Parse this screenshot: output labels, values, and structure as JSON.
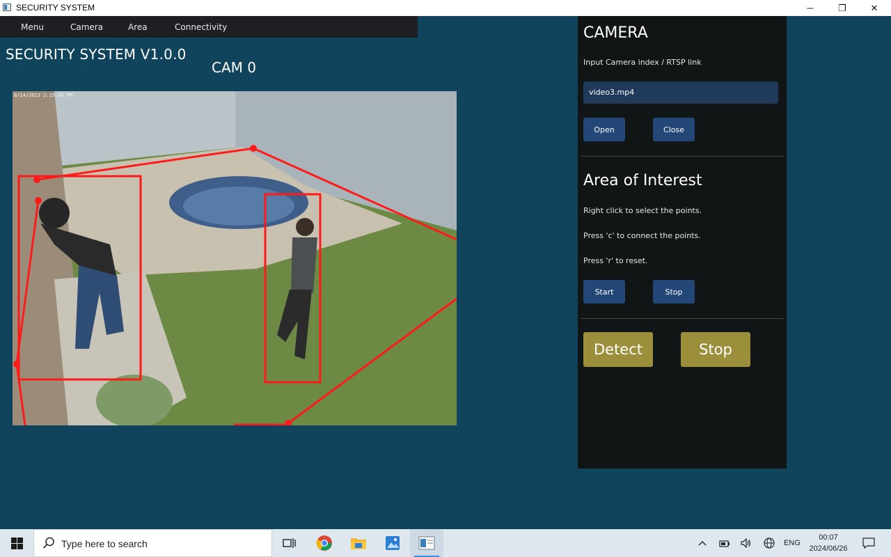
{
  "window": {
    "title": "SECURITY SYSTEM",
    "controls": {
      "minimize": "─",
      "restore": "❐",
      "close": "✕"
    }
  },
  "menubar": {
    "items": [
      "Menu",
      "Camera",
      "Area",
      "Connectivity"
    ]
  },
  "main": {
    "app_title": "SECURITY SYSTEM V1.0.0",
    "cam_label": "CAM 0",
    "video_timestamp": "8/14/2013 2:15:49 PM",
    "overlay_color": "#ff1a1a"
  },
  "panel": {
    "camera_heading": "CAMERA",
    "camera_prompt": "Input Camera index / RTSP link",
    "camera_input_value": "video3.mp4",
    "open_label": "Open",
    "close_label": "Close",
    "area_heading": "Area of Interest",
    "instructions": [
      "Right click to select the points.",
      "Press 'c' to connect the points.",
      "Press 'r' to reset."
    ],
    "start_label": "Start",
    "stop_label": "Stop",
    "detect_label": "Detect",
    "stop_detect_label": "Stop",
    "accent_detect": "#9c8f3b",
    "accent_button": "#234878"
  },
  "taskbar": {
    "search_placeholder": "Type here to search",
    "apps": [
      "task-view-icon",
      "chrome-icon",
      "file-explorer-icon",
      "photos-icon",
      "security-app-icon"
    ],
    "tray": {
      "language": "ENG",
      "time": "00:07",
      "date": "2024/06/26"
    }
  }
}
